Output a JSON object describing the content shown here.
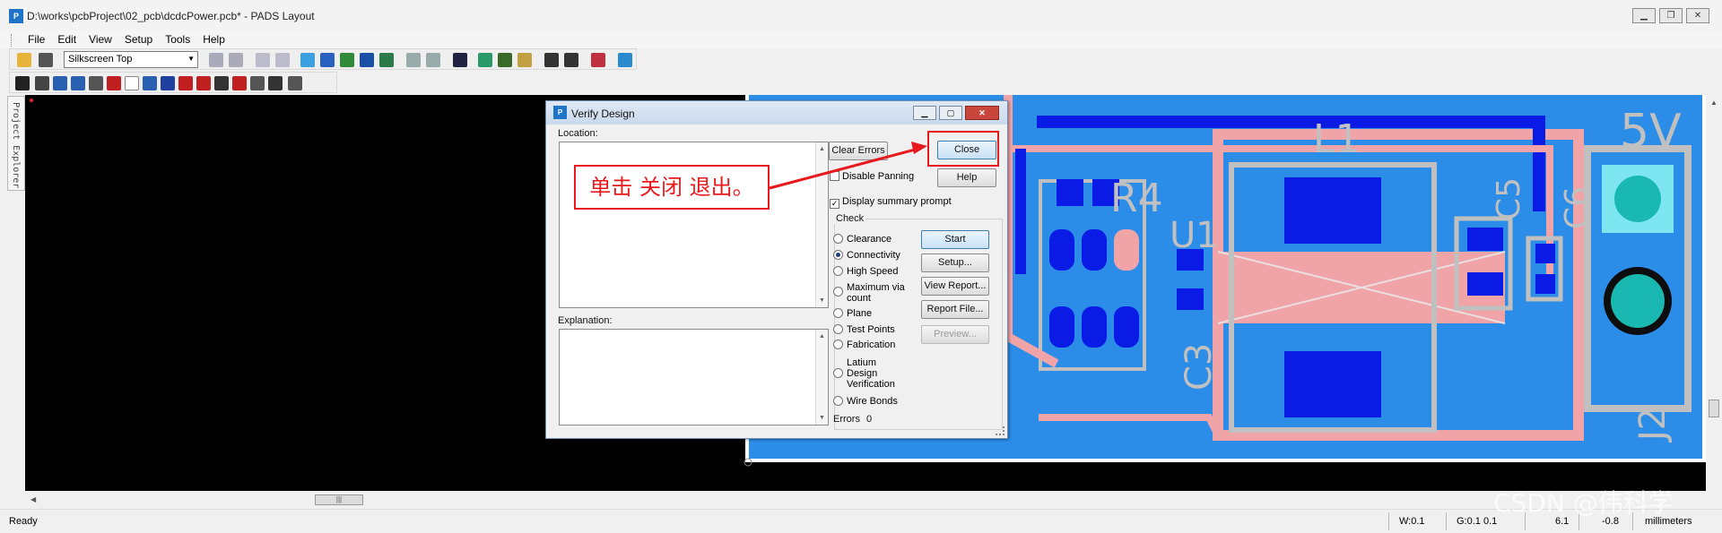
{
  "window": {
    "title": "D:\\works\\pcbProject\\02_pcb\\dcdcPower.pcb* - PADS Layout",
    "app_icon": "pads-logo-icon"
  },
  "menu": [
    "File",
    "Edit",
    "View",
    "Setup",
    "Tools",
    "Help"
  ],
  "toolbar": {
    "layer_select": "Silkscreen Top"
  },
  "side_panel": {
    "label": "Project Explorer"
  },
  "pcb": {
    "labels": [
      "5V",
      "L1",
      "R4",
      "U1",
      "C5",
      "C6",
      "C3",
      "J2"
    ],
    "colors": {
      "board": "#2b8de8",
      "trace": "#0a1be6",
      "outline": "#f0a4a8",
      "silk": "#c0c0c0",
      "pad_teal": "#19b8b0"
    }
  },
  "dialog": {
    "title": "Verify Design",
    "location_label": "Location:",
    "explanation_label": "Explanation:",
    "buttons": {
      "clear_errors": "Clear Errors",
      "close": "Close",
      "help": "Help",
      "start": "Start",
      "setup": "Setup...",
      "view_report": "View Report...",
      "report_file": "Report File...",
      "preview": "Preview..."
    },
    "disable_panning": "Disable Panning",
    "display_summary": "Display summary prompt",
    "check_group": "Check",
    "checks": [
      {
        "label": "Clearance",
        "selected": false
      },
      {
        "label": "Connectivity",
        "selected": true
      },
      {
        "label": "High Speed",
        "selected": false
      },
      {
        "label": "Maximum via count",
        "selected": false
      },
      {
        "label": "Plane",
        "selected": false
      },
      {
        "label": "Test Points",
        "selected": false
      },
      {
        "label": "Fabrication",
        "selected": false
      },
      {
        "label": "Latium Design Verification",
        "selected": false
      },
      {
        "label": "Wire Bonds",
        "selected": false
      }
    ],
    "errors_label": "Errors",
    "errors_count": "0"
  },
  "annotation": {
    "text": "单击 关闭 退出。"
  },
  "status": {
    "ready": "Ready",
    "w": "W:0.1",
    "g": "G:0.1 0.1",
    "x": "-0.8",
    "y": "6.1",
    "units": "millimeters"
  },
  "watermark": "CSDN @伟科学"
}
